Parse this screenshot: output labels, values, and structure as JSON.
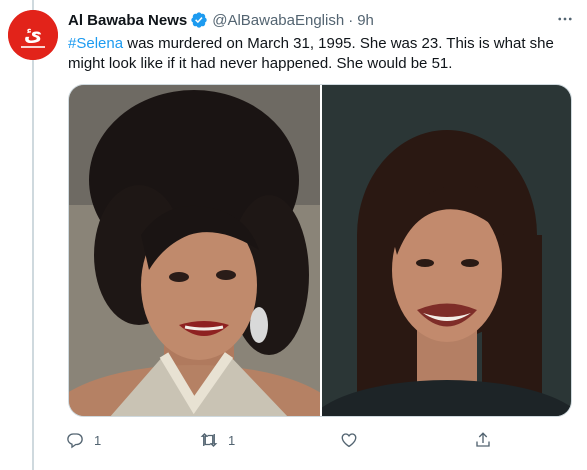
{
  "tweet": {
    "author": {
      "display_name": "Al Bawaba News",
      "handle": "@AlBawabaEnglish",
      "separator": "·",
      "time": "9h",
      "avatar_text": "ئ"
    },
    "text": {
      "hashtag": "#Selena",
      "line1_rest": " was murdered on March 31, 1995. She was 23. This is what she",
      "line2": "might look like if it had never happened. She would be 51."
    },
    "media": {
      "left_photo": "photo-young-woman",
      "right_photo": "photo-older-woman"
    },
    "actions": {
      "reply_count": "1",
      "retweet_count": "1"
    }
  },
  "colors": {
    "link": "#1d9bf0",
    "secondary_text": "#536471",
    "avatar_bg": "#e2231a",
    "verified": "#1d9bf0"
  },
  "icons": [
    "verified-badge-icon",
    "more-options-icon",
    "reply-icon",
    "retweet-icon",
    "like-icon",
    "share-icon"
  ]
}
